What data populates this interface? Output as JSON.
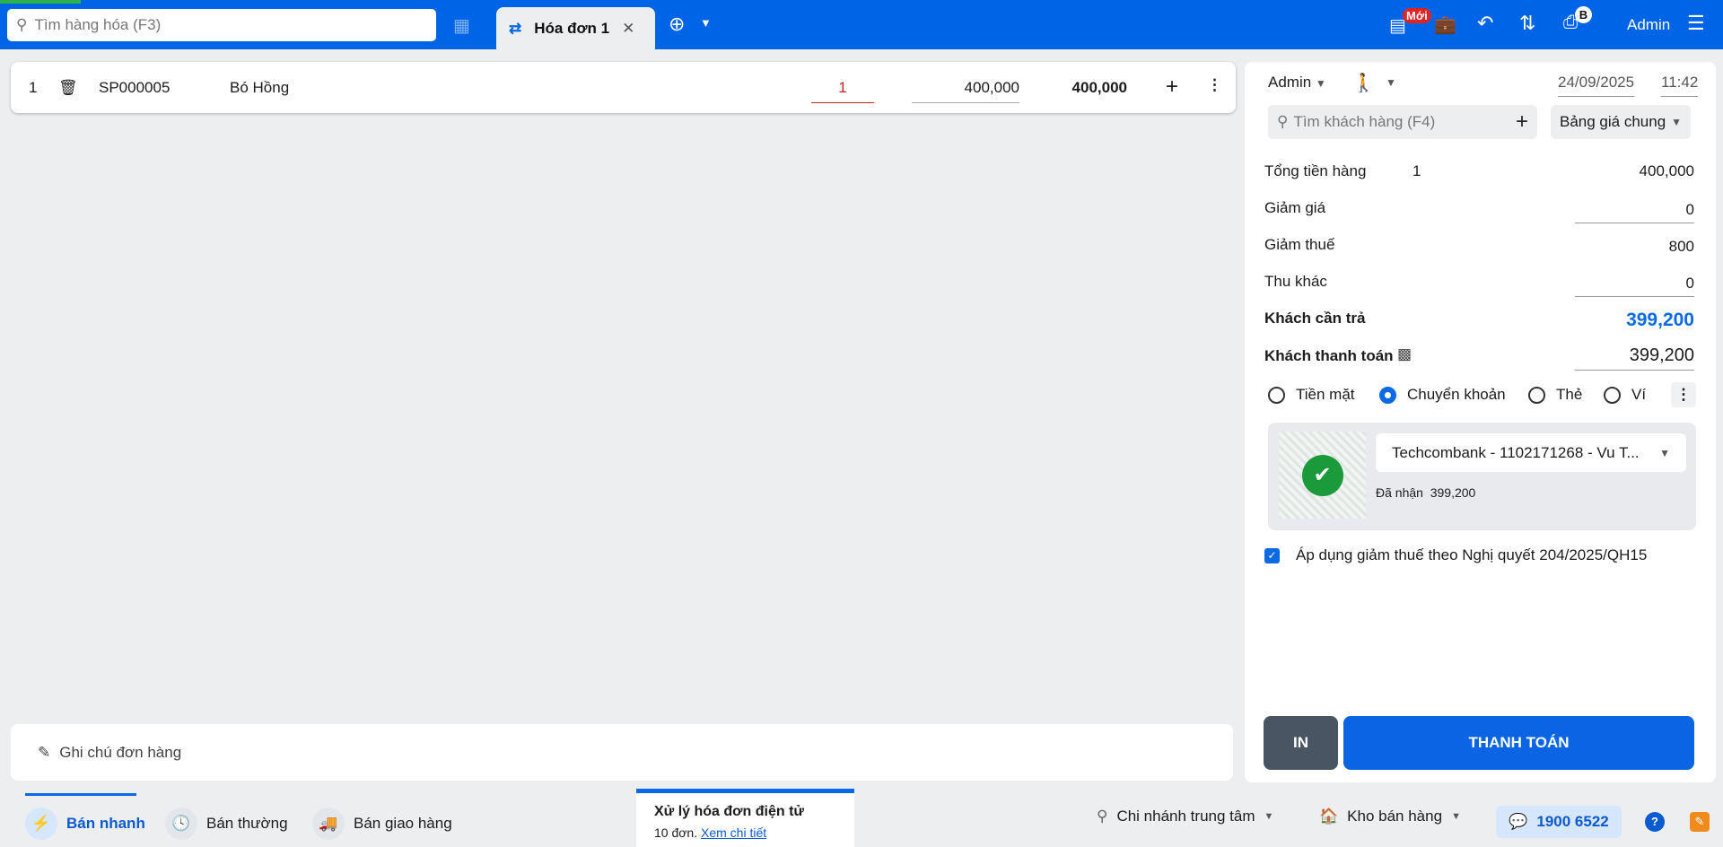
{
  "topbar": {
    "search_placeholder": "Tìm hàng hóa (F3)",
    "tab_label": "Hóa đơn 1",
    "new_badge": "Mới",
    "printer_badge": "B",
    "user": "Admin"
  },
  "cart": {
    "items": [
      {
        "index": "1",
        "code": "SP000005",
        "name": "Bó Hồng",
        "qty": "1",
        "price": "400,000",
        "total": "400,000"
      }
    ]
  },
  "panel": {
    "seller": "Admin",
    "date": "24/09/2025",
    "time": "11:42",
    "customer_placeholder": "Tìm khách hàng (F4)",
    "price_list": "Bảng giá chung",
    "subtotal_label": "Tổng tiền hàng",
    "subtotal_count": "1",
    "subtotal": "400,000",
    "discount_label": "Giảm giá",
    "discount": "0",
    "tax_reduction_label": "Giảm thuế",
    "tax_reduction": "800",
    "other_label": "Thu khác",
    "other": "0",
    "due_label": "Khách cần trả",
    "due": "399,200",
    "paid_label": "Khách thanh toán",
    "paid": "399,200",
    "methods": [
      "Tiền mặt",
      "Chuyển khoản",
      "Thẻ",
      "Ví"
    ],
    "bank": "Techcombank - 1102171268 - Vu T...",
    "received_label": "Đã nhận",
    "received": "399,200",
    "tax_checkbox": "Áp dụng giảm thuế theo Nghị quyết 204/2025/QH15",
    "print_btn": "IN",
    "pay_btn": "THANH TOÁN"
  },
  "note_placeholder": "Ghi chú đơn hàng",
  "bottom": {
    "quick": "Bán nhanh",
    "normal": "Bán thường",
    "delivery": "Bán giao hàng",
    "einvoice_title": "Xử lý hóa đơn điện tử",
    "einvoice_count": "10 đơn.",
    "einvoice_link": "Xem chi tiết",
    "branch": "Chi nhánh trung tâm",
    "warehouse": "Kho bán hàng",
    "hotline": "1900 6522"
  },
  "colors": {
    "brand": "#0064e6",
    "due": "#0a6ae6",
    "success": "#1a9a3a"
  }
}
